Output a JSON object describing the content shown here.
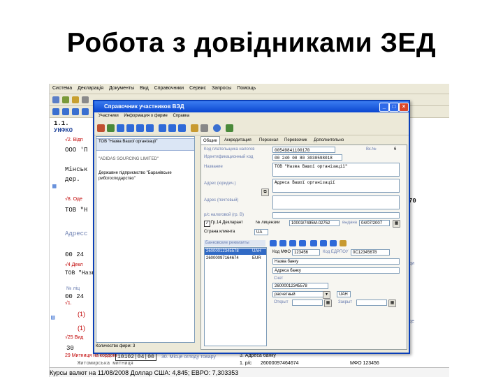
{
  "slide": {
    "title": "Робота з довідниками ЗЕД"
  },
  "app": {
    "menu": [
      "Система",
      "Декларація",
      "Документы",
      "Вид",
      "Справочники",
      "Сервис",
      "Запросы",
      "Помощь"
    ],
    "background": {
      "line1": "1.1.",
      "line2": "УНФКО",
      "line3": "√2. Відп",
      "line4": "ООО 'П",
      "line5": "Мінськ",
      "line6": "дер.",
      "line7": "√8. Оде",
      "line8": "ТОВ \"Н",
      "line9": "Адресс",
      "line10": "00  24",
      "line11": "√4 Декл",
      "line12": "ТОВ \"Назв",
      "line13": "№ ліц",
      "line14": "00  24",
      "line15": "√1. ",
      "line16": "(1)",
      "line17": "(1)",
      "line18": "√25 Вид",
      "line19": "30",
      "line20": "29 Митниця на кордоні",
      "line21": "Житомирська митниця",
      "right1": "70",
      "right2": "ди",
      "right3": "де",
      "bottom_field": "10102|04|00",
      "bottom_mid": "30. Місце огляду товару",
      "bottom_right1": "3. Адреса банку",
      "bottom_right2": "1. р/с",
      "bottom_right3": "26000097464674",
      "bottom_right4": "МФО 123456"
    },
    "status_text": "Курсы валют на 11/08/2008  Доллар США: 4,845; ЕВРО: 7,303353"
  },
  "dialog": {
    "title": "Справочник участников ВЭД",
    "menu": [
      "Участники",
      "Информация о фирме",
      "Справка"
    ],
    "list": [
      "ТОВ \"Назва Вашої організації\"",
      "\"ADIDAS SOURCING LIMITED\"",
      "Державне підприємство \"Баранівське рибогосподарство\""
    ],
    "count": "Количество фирм: 3",
    "tabs": [
      "Общие",
      "Аккредитация",
      "Персонал",
      "Перевозчик",
      "Дополнительно"
    ],
    "fields": {
      "tax_code_label": "Код плательщика налогов",
      "tax_code_value": "00549841100170",
      "vk_label": "Вк.№",
      "vk_value": "6",
      "id_code_label": "Идентификационный код",
      "id_code_value": "00  240  00  80    3030598018",
      "name_label": "Название",
      "name_value": "ТОВ \"Назва Вашої організації\"",
      "legal_addr_label": "Адрес (юридич.)",
      "legal_addr_value": "Адреса Вашої організації",
      "post_addr_label": "Адрес (почтовый)",
      "tax_acc_label": "р/с налоговой (гр. В)",
      "gr14_label": "Гр.14 Декларант",
      "license_label": "№ лицензии",
      "license_value": "10003/7495M-02752",
      "issued_label": "выдана",
      "issued_value": "04/07/2007",
      "country_label": "Страна клиента",
      "country_value": "UA"
    },
    "bank": {
      "header": "Банковские реквизиты",
      "accounts": [
        {
          "number": "26000012345578",
          "currency": "UAH"
        },
        {
          "number": "26000097164674",
          "currency": "EUR"
        }
      ],
      "mfo_label": "Код МФО",
      "mfo_value": "123456",
      "edrpou_label": "Код ЕДРПОУ",
      "edrpou_value": "0C12345678",
      "bank_name": "Назва банку",
      "bank_address": "Адреса банку",
      "account_label": "Счет",
      "account_value": "26000012345578",
      "account_type": "расчетный",
      "currency_value": "UAH",
      "opened_label": "Открыт",
      "closed_label": "Закрыт"
    }
  }
}
